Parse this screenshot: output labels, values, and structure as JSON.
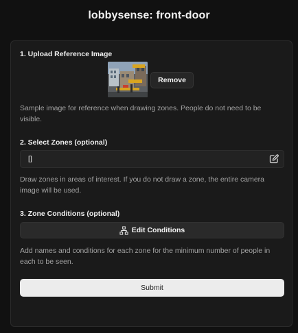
{
  "app": {
    "title": "lobbysense: front-door"
  },
  "upload": {
    "heading": "1. Upload Reference Image",
    "remove_label": "Remove",
    "help": "Sample image for reference when drawing zones. People do not need to be visible."
  },
  "zones": {
    "heading": "2. Select Zones (optional)",
    "value": "[]",
    "edit_icon": "pencil-square-icon",
    "help": "Draw zones in areas of interest. If you do not draw a zone, the entire camera image will be used."
  },
  "conditions": {
    "heading": "3. Zone Conditions (optional)",
    "button_label": "Edit Conditions",
    "button_icon": "flow-tree-icon",
    "help": "Add names and conditions for each zone for the minimum number of people in each to be seen."
  },
  "submit": {
    "label": "Submit"
  },
  "colors": {
    "background": "#111111",
    "panel": "#1a1a1a",
    "submit_bg": "#ececec"
  }
}
